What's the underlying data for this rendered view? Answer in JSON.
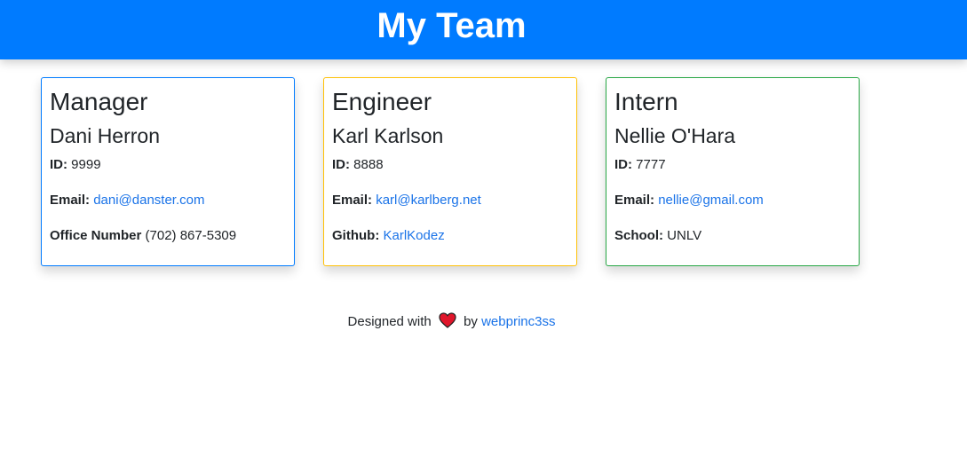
{
  "header": {
    "title": "My Team"
  },
  "cards": [
    {
      "role": "Manager",
      "name": "Dani Herron",
      "id_label": "ID:",
      "id": "9999",
      "email_label": "Email:",
      "email": "dani@danster.com",
      "extra_label": "Office Number",
      "extra_value": "(702) 867-5309",
      "accent": "#007bff"
    },
    {
      "role": "Engineer",
      "name": "Karl Karlson",
      "id_label": "ID:",
      "id": "8888",
      "email_label": "Email:",
      "email": "karl@karlberg.net",
      "extra_label": "Github:",
      "extra_value": "KarlKodez",
      "accent": "#ffc107"
    },
    {
      "role": "Intern",
      "name": "Nellie O'Hara",
      "id_label": "ID:",
      "id": "7777",
      "email_label": "Email:",
      "email": "nellie@gmail.com",
      "extra_label": "School:",
      "extra_value": "UNLV",
      "accent": "#28a745"
    }
  ],
  "footer": {
    "prefix": "Designed with",
    "heart_icon": "heart-icon",
    "middle": "by",
    "author": "webprinc3ss"
  },
  "colors": {
    "header_bg": "#007bff",
    "link": "#1a73e8",
    "heart": "#e0162b"
  }
}
